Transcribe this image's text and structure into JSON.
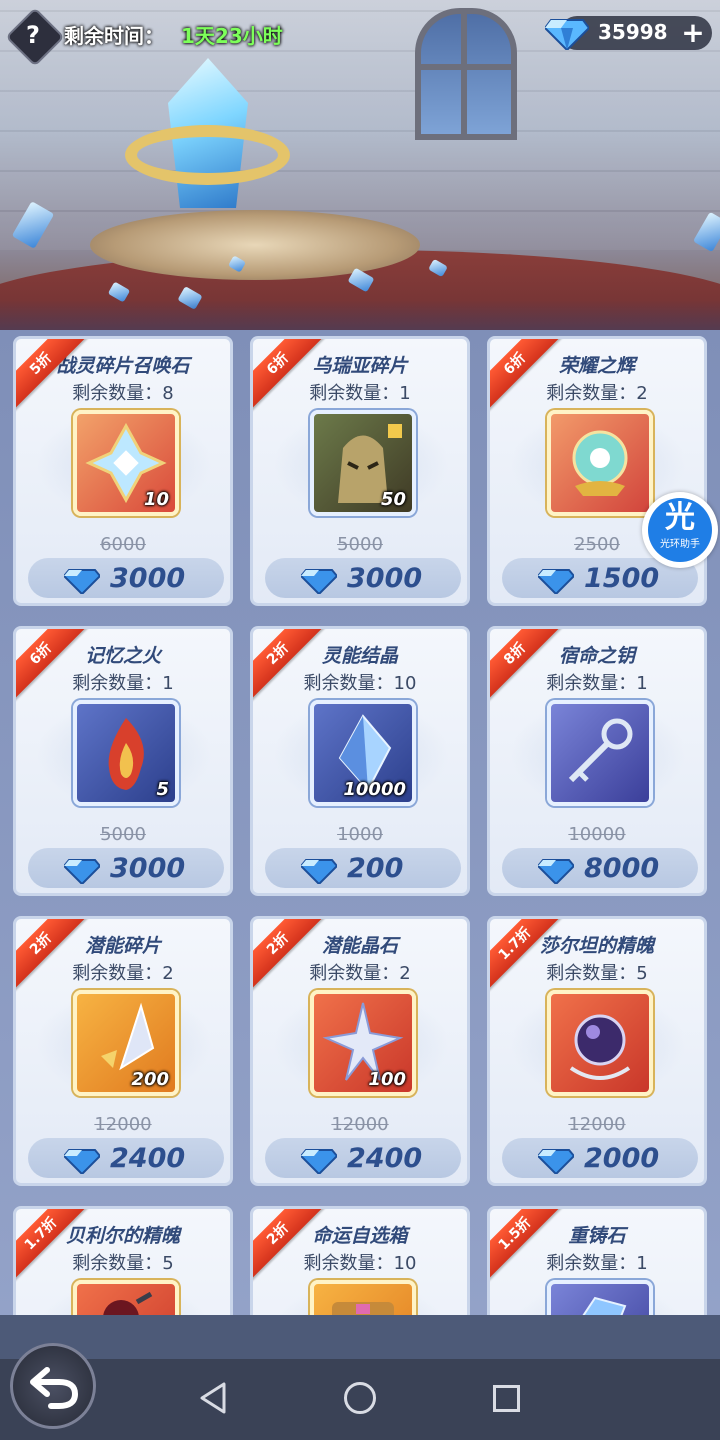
{
  "header": {
    "help_glyph": "?",
    "timer_label": "剩余时间：",
    "timer_value": "1天23小时",
    "currency_value": "35998",
    "plus_glyph": "+"
  },
  "helper_badge": {
    "glyph": "光",
    "text": "光环助手"
  },
  "icons": {
    "help": "question-icon",
    "currency": "diamond-icon",
    "back": "back-arrow-icon",
    "nav_back": "triangle-back-icon",
    "nav_home": "circle-home-icon",
    "nav_recent": "square-recent-icon"
  },
  "colors": {
    "accent_text": "#314a7a",
    "timer": "#7dff5a",
    "ribbon": "#e23d22",
    "price": "#2d4f8e"
  },
  "items": [
    {
      "discount": "5折",
      "name": "战灵碎片召唤石",
      "remain": "剩余数量：8",
      "qty": "10",
      "old_price": "6000",
      "price": "3000"
    },
    {
      "discount": "6折",
      "name": "乌瑞亚碎片",
      "remain": "剩余数量：1",
      "qty": "50",
      "old_price": "5000",
      "price": "3000"
    },
    {
      "discount": "6折",
      "name": "荣耀之辉",
      "remain": "剩余数量：2",
      "qty": "",
      "old_price": "2500",
      "price": "1500"
    },
    {
      "discount": "6折",
      "name": "记忆之火",
      "remain": "剩余数量：1",
      "qty": "5",
      "old_price": "5000",
      "price": "3000"
    },
    {
      "discount": "2折",
      "name": "灵能结晶",
      "remain": "剩余数量：10",
      "qty": "10000",
      "old_price": "1000",
      "price": "200"
    },
    {
      "discount": "8折",
      "name": "宿命之钥",
      "remain": "剩余数量：1",
      "qty": "",
      "old_price": "10000",
      "price": "8000"
    },
    {
      "discount": "2折",
      "name": "潜能碎片",
      "remain": "剩余数量：2",
      "qty": "200",
      "old_price": "12000",
      "price": "2400"
    },
    {
      "discount": "2折",
      "name": "潜能晶石",
      "remain": "剩余数量：2",
      "qty": "100",
      "old_price": "12000",
      "price": "2400"
    },
    {
      "discount": "1.7折",
      "name": "莎尔坦的精魄",
      "remain": "剩余数量：5",
      "qty": "",
      "old_price": "12000",
      "price": "2000"
    },
    {
      "discount": "1.7折",
      "name": "贝利尔的精魄",
      "remain": "剩余数量：5",
      "qty": "",
      "old_price": "",
      "price": ""
    },
    {
      "discount": "2折",
      "name": "命运自选箱",
      "remain": "剩余数量：10",
      "qty": "",
      "old_price": "",
      "price": ""
    },
    {
      "discount": "1.5折",
      "name": "重铸石",
      "remain": "剩余数量：1",
      "qty": "",
      "old_price": "",
      "price": ""
    }
  ]
}
